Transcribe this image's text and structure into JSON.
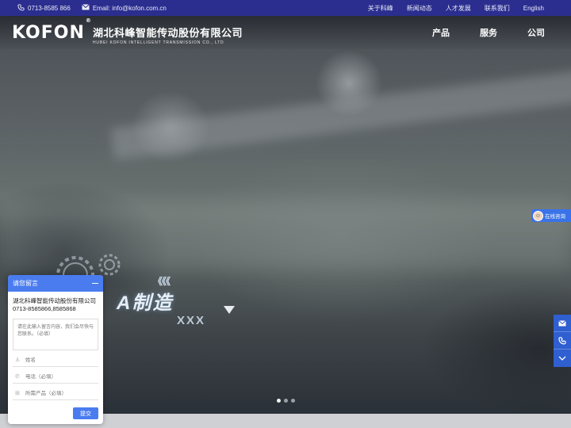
{
  "topbar": {
    "phone_icon": "phone-icon",
    "phone": "0713-8585 866",
    "email_icon": "mail-icon",
    "email": "Email: info@kofon.com.cn",
    "links": [
      "关于科峰",
      "新闻动态",
      "人才发展",
      "联系我们",
      "English"
    ]
  },
  "header": {
    "logo": "KOFON",
    "logo_mark": "®",
    "company_cn": "湖北科峰智能传动股份有限公司",
    "company_en": "HUBEI KOFON INTELLIGENT TRANSMISSION CO., LTD",
    "nav": [
      "产品",
      "服务",
      "公司"
    ]
  },
  "hero": {
    "slogan": "A制造",
    "chevrons": "《《《",
    "xxx": "XXX",
    "slides": 3,
    "active_slide": 1
  },
  "chat": {
    "title": "请您留言",
    "company": "湖北科峰智能传动股份有限公司0713-8585866,8585868",
    "message_placeholder": "请在此输入留言内容，我们会尽快与您联系。（必填）",
    "name_placeholder": "姓名",
    "phone_placeholder": "电话（必填）",
    "product_placeholder": "所需产品（必填）",
    "submit": "提交"
  },
  "consult": {
    "label": "在线咨询"
  },
  "sidebar": {
    "icons": [
      "mail-icon",
      "phone-icon",
      "chevron-down-icon"
    ]
  },
  "colors": {
    "topbar": "#2b2e8f",
    "accent": "#4a7cf0",
    "sidebar": "#2f5fd0"
  }
}
